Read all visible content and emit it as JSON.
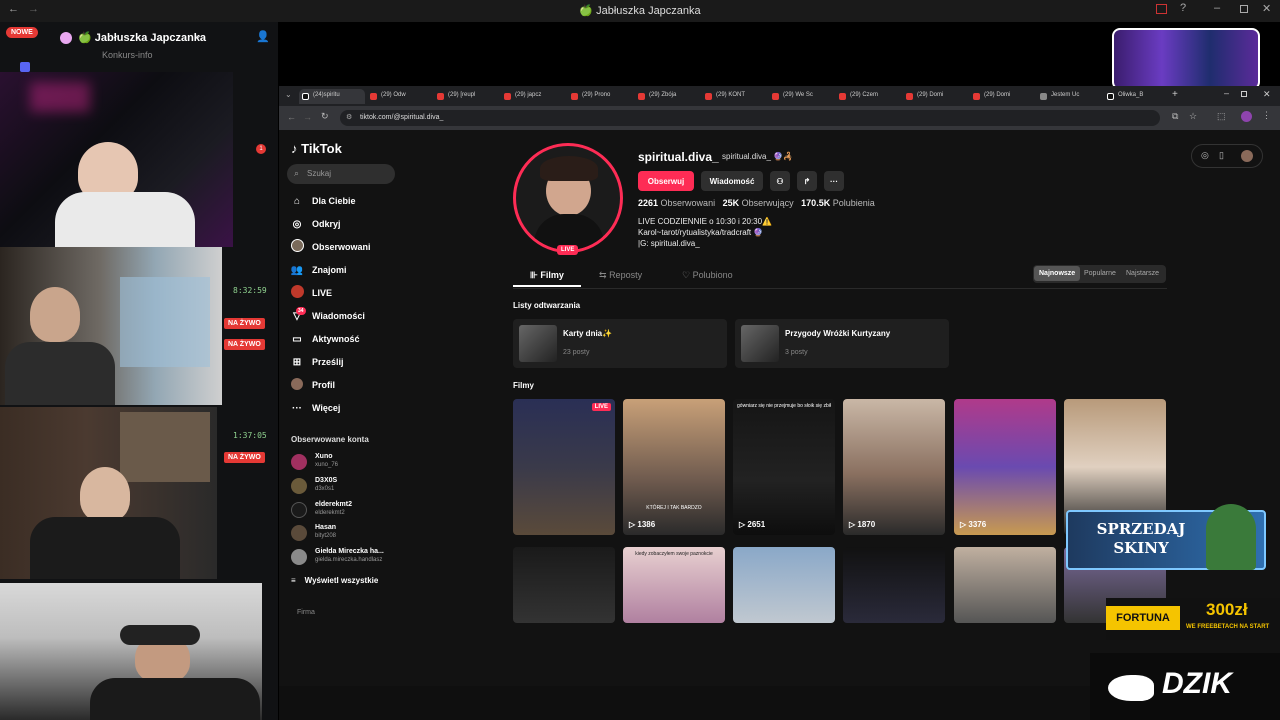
{
  "window": {
    "title": "🍏 Jabłuszka Japczanka"
  },
  "discord": {
    "new_badge": "NOWE",
    "server_name": "🍏 Jabłuszka Japczanka",
    "channel": "Konkurs-info",
    "notif_count": "1"
  },
  "streams": [
    {
      "timer": "8:32:59",
      "live": "NA ŻYWO"
    },
    {
      "timer": "",
      "live": "NA ŻYWO"
    },
    {
      "timer": "1:37:05",
      "live": "NA ŻYWO"
    }
  ],
  "browser": {
    "tabs": [
      {
        "label": "(24)spiritu",
        "active": true
      },
      {
        "label": "(29) Odw"
      },
      {
        "label": "(29) [reupl"
      },
      {
        "label": "(29) japcz"
      },
      {
        "label": "(29) Prono"
      },
      {
        "label": "(29) Zbója"
      },
      {
        "label": "(29) KONT"
      },
      {
        "label": "(29) We Sc"
      },
      {
        "label": "(29) Czem"
      },
      {
        "label": "(29) Domi"
      },
      {
        "label": "(29) Domi"
      },
      {
        "label": "Jestem Uc"
      },
      {
        "label": "Oliwka_B"
      }
    ],
    "url": "tiktok.com/@spiritual.diva_"
  },
  "tiktok": {
    "logo": "TikTok",
    "search_placeholder": "Szukaj",
    "nav": [
      {
        "icon": "home-icon",
        "label": "Dla Ciebie"
      },
      {
        "icon": "compass-icon",
        "label": "Odkryj"
      },
      {
        "icon": "following-icon",
        "label": "Obserwowani"
      },
      {
        "icon": "friends-icon",
        "label": "Znajomi"
      },
      {
        "icon": "live-icon",
        "label": "LIVE"
      },
      {
        "icon": "messages-icon",
        "label": "Wiadomości",
        "badge": "34"
      },
      {
        "icon": "activity-icon",
        "label": "Aktywność"
      },
      {
        "icon": "upload-icon",
        "label": "Prześlij"
      },
      {
        "icon": "profile-icon",
        "label": "Profil"
      },
      {
        "icon": "more-icon",
        "label": "Więcej"
      }
    ],
    "followed_title": "Obserwowane konta",
    "followed": [
      {
        "name": "Xuno",
        "handle": "xuno_76"
      },
      {
        "name": "D3X0S",
        "handle": "d3x0s1"
      },
      {
        "name": "elderekmt2",
        "handle": "elderekmt2"
      },
      {
        "name": "Hasan",
        "handle": "bityt208"
      },
      {
        "name": "Giełda Mireczka ha...",
        "handle": "gielda.mireczka.handlasz"
      }
    ],
    "show_all": "Wyświetl wszystkie",
    "company": "Firma",
    "profile": {
      "username": "spiritual.diva_",
      "nickname": "spiritual.diva_ 🔮🦂",
      "follow_btn": "Obserwuj",
      "message_btn": "Wiadomość",
      "following_count": "2261",
      "following_label": "Obserwowani",
      "followers_count": "25K",
      "followers_label": "Obserwujący",
      "likes_count": "170.5K",
      "likes_label": "Polubienia",
      "bio1": "LIVE CODZIENNIE o 10:30 i 20:30⚠️",
      "bio2": "Karol~tarot/rytualistyka/tradcraft 🔮",
      "bio3": "|G: spiritual.diva_",
      "live_badge": "LIVE"
    },
    "tabs": {
      "videos": "Filmy",
      "reposts": "Reposty",
      "liked": "Polubiono"
    },
    "sort": {
      "newest": "Najnowsze",
      "popular": "Popularne",
      "oldest": "Najstarsze"
    },
    "playlists_title": "Listy odtwarzania",
    "playlists": [
      {
        "title": "Karty dnia✨",
        "count": "23 posty"
      },
      {
        "title": "Przygody Wróżki Kurtyzany",
        "count": "3 posty"
      }
    ],
    "videos_title": "Filmy",
    "videos_row1": [
      {
        "views": "",
        "live": "LIVE",
        "caption": ""
      },
      {
        "views": "1386",
        "caption": "KTÓREJ I TAK BARDZO"
      },
      {
        "views": "2651",
        "caption": "gówniarz się nie przejmuje bo słoik się zbił"
      },
      {
        "views": "1870",
        "caption": ""
      },
      {
        "views": "3376",
        "caption": ""
      },
      {
        "views": "",
        "caption": ""
      }
    ],
    "videos_row2": [
      {
        "caption": ""
      },
      {
        "caption": "kiedy zobaczyłem swoje paznokcie"
      },
      {
        "caption": ""
      },
      {
        "caption": ""
      },
      {
        "caption": ""
      },
      {
        "caption": ""
      }
    ]
  },
  "ads": {
    "skins": "SPRZEDAJ SKINY",
    "fortuna_brand": "FORTUNA",
    "fortuna_amount": "300zł",
    "fortuna_sub": "WE FREEBETACH NA START",
    "dzik": "DZIK"
  }
}
